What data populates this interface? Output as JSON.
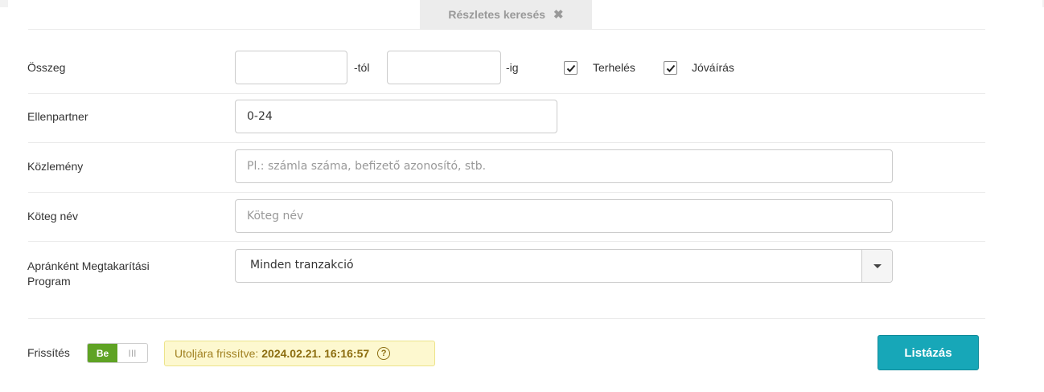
{
  "tab": {
    "label": "Részletes keresés",
    "close_glyph": "✖"
  },
  "amount": {
    "label": "Összeg",
    "from_suffix": "-tól",
    "to_suffix": "-ig",
    "from_value": "",
    "to_value": "",
    "debit": {
      "label": "Terhelés",
      "checked": true
    },
    "credit": {
      "label": "Jóváírás",
      "checked": true
    }
  },
  "partner": {
    "label": "Ellenpartner",
    "value": "0-24"
  },
  "memo": {
    "label": "Közlemény",
    "placeholder": "Pl.: számla száma, befizető azonosító, stb."
  },
  "batch": {
    "label": "Köteg név",
    "placeholder": "Köteg név"
  },
  "savings": {
    "label_line1": "Apránként Megtakarítási",
    "label_line2": "Program",
    "selected": "Minden tranzakció"
  },
  "refresh": {
    "label": "Frissítés",
    "toggle_on": "Be",
    "toggle_off": "III",
    "status_prefix": "Utoljára frissítve:",
    "status_time": "2024.02.21. 16:16:57",
    "help_glyph": "?"
  },
  "list_button": "Listázás",
  "colors": {
    "accent": "#17a7b8",
    "toggle_on": "#5fa324",
    "status_bg": "#fdf8cf"
  }
}
